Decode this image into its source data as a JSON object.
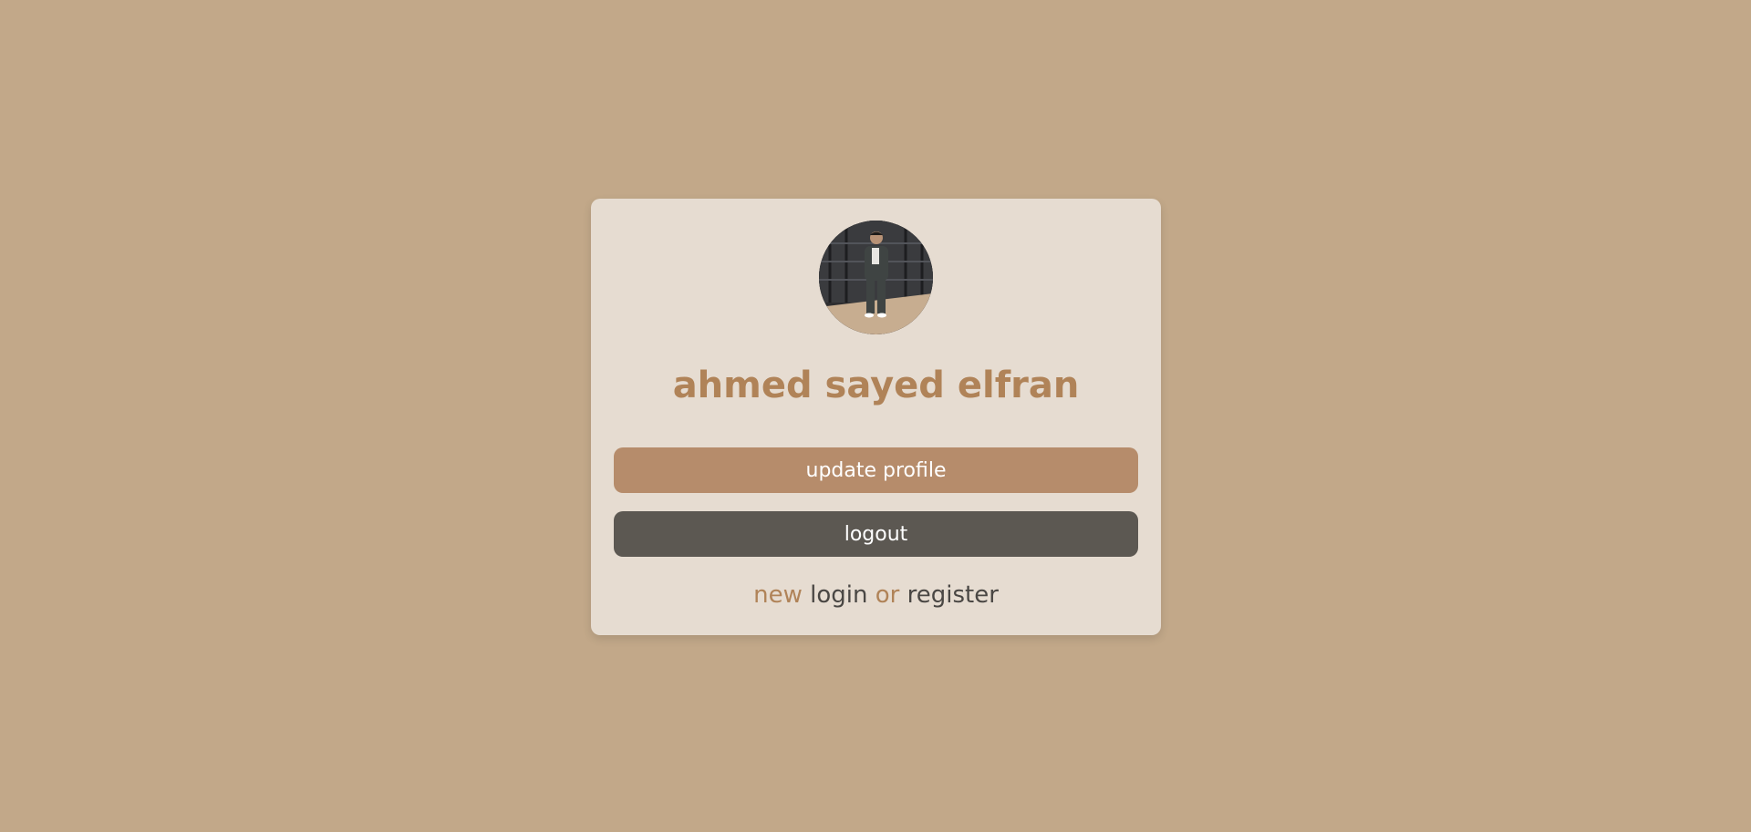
{
  "profile": {
    "avatar_alt": "profile photo",
    "name": "ahmed sayed elfran"
  },
  "actions": {
    "update_label": "update profile",
    "logout_label": "logout"
  },
  "auth": {
    "prefix": "new",
    "login_label": "login",
    "separator": "or",
    "register_label": "register"
  },
  "colors": {
    "background": "#c2a889",
    "card": "#e6dcd1",
    "accent": "#b08358",
    "update_button": "#b68c6b",
    "logout_button": "#5c5852",
    "dark_text": "#4a4744"
  }
}
